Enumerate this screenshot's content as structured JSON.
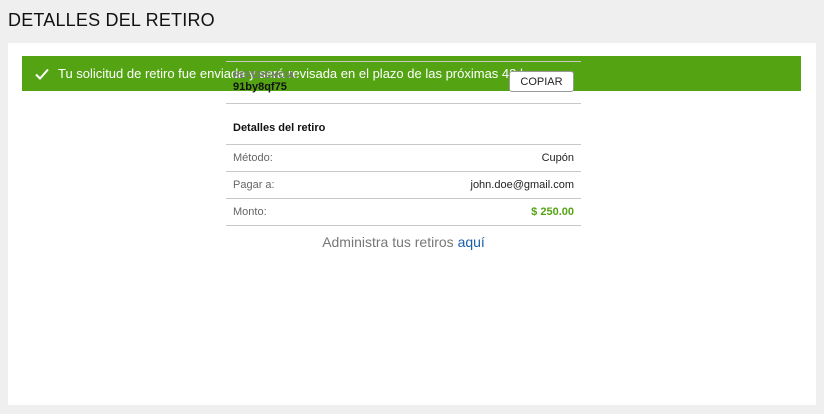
{
  "page": {
    "title": "DETALLES DEL RETIRO"
  },
  "banner": {
    "message": "Tu solicitud de retiro fue enviada y será revisada en el plazo de las próximas 48 horas.",
    "icon": "check-icon",
    "color": "#54a313"
  },
  "reference": {
    "label": "REFERENCIA:",
    "value": "91by8qf75",
    "copy_label": "COPIAR"
  },
  "details": {
    "title": "Detalles del retiro",
    "rows": [
      {
        "key": "Método:",
        "value": "Cupón"
      },
      {
        "key": "Pagar a:",
        "value": "john.doe@gmail.com"
      },
      {
        "key": "Monto:",
        "value": "$ 250.00"
      }
    ],
    "amount_color": "#54a313"
  },
  "footer": {
    "text": "Administra tus retiros ",
    "link_label": "aquí"
  }
}
